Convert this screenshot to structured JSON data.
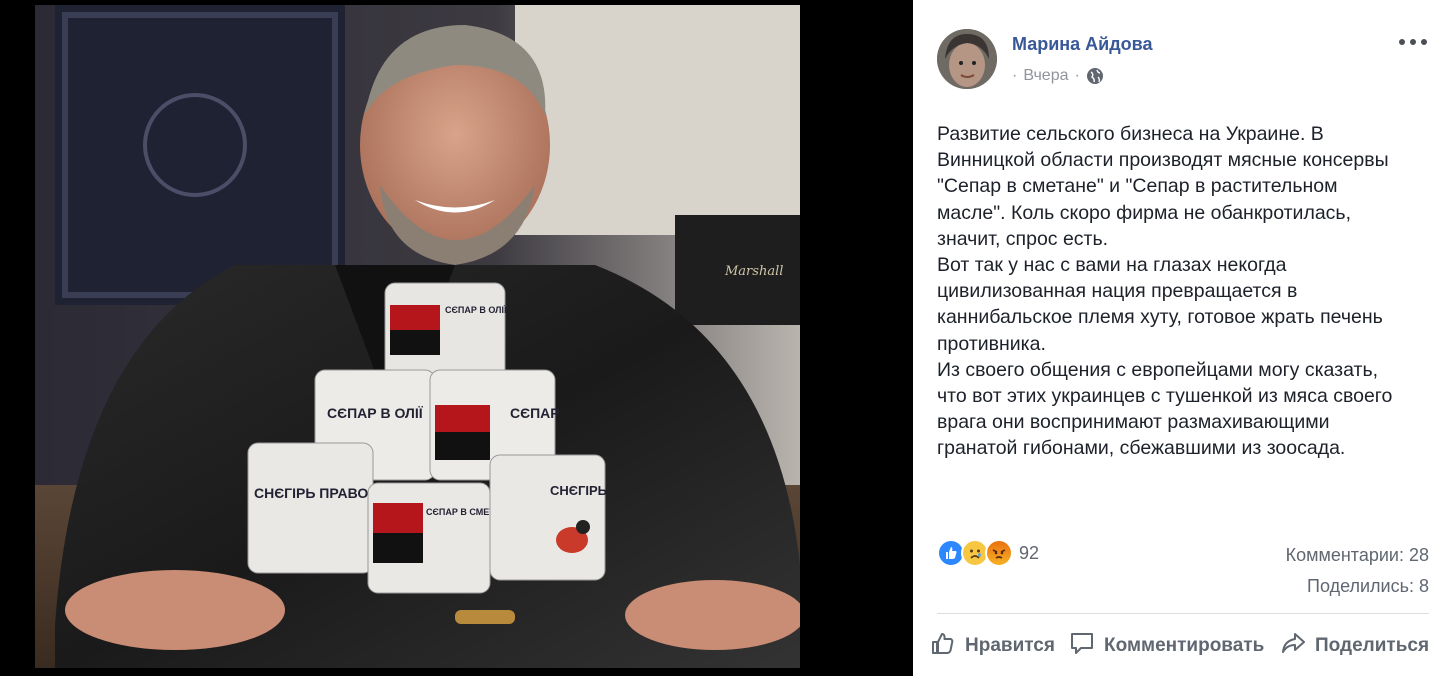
{
  "post": {
    "author": "Марина Айдова",
    "time_prefix": "·",
    "time": "Вчера",
    "text_lines": [
      "Развитие сельского бизнеса на Украине. В",
      "Винницкой области производят мясные консервы",
      "\"Сепар в сметане\" и \"Сепар в растительном",
      "масле\". Коль скоро фирма не обанкротилась,",
      "значит, спрос есть.",
      "Вот так у нас с вами на глазах некогда",
      "цивилизованная нация превращается в",
      "каннибальское племя хуту, готовое жрать печень",
      "противника.",
      "Из своего общения с европейцами могу сказать,",
      "что вот этих украинцев с тушенкой из мяса своего",
      "врага они воспринимают размахивающими",
      "гранатой гибонами, сбежавшими из зоосада."
    ],
    "reactions": [
      "like-icon",
      "sad-icon",
      "angry-icon"
    ],
    "reaction_count": "92",
    "comments": "Комментарии: 28",
    "shares": "Поделились: 8"
  },
  "actions": {
    "like": "Нравится",
    "comment": "Комментировать",
    "share": "Поделиться"
  },
  "photo": {
    "cans": [
      {
        "label": "СЄПАР В ОЛІЇ"
      },
      {
        "label": "СЄПАР В ОЛІЇ"
      },
      {
        "label": "СЄПАР"
      },
      {
        "label": "СНЄГІРЬ ПРАВО"
      },
      {
        "label": "СЄПАР В СМЕТАНІ"
      },
      {
        "label": "СНЄГІРЬ"
      }
    ],
    "amp_brand": "Marshall"
  },
  "colors": {
    "link": "#385898",
    "text": "#1d2129",
    "muted": "#606770",
    "like": "#2d88ff"
  }
}
